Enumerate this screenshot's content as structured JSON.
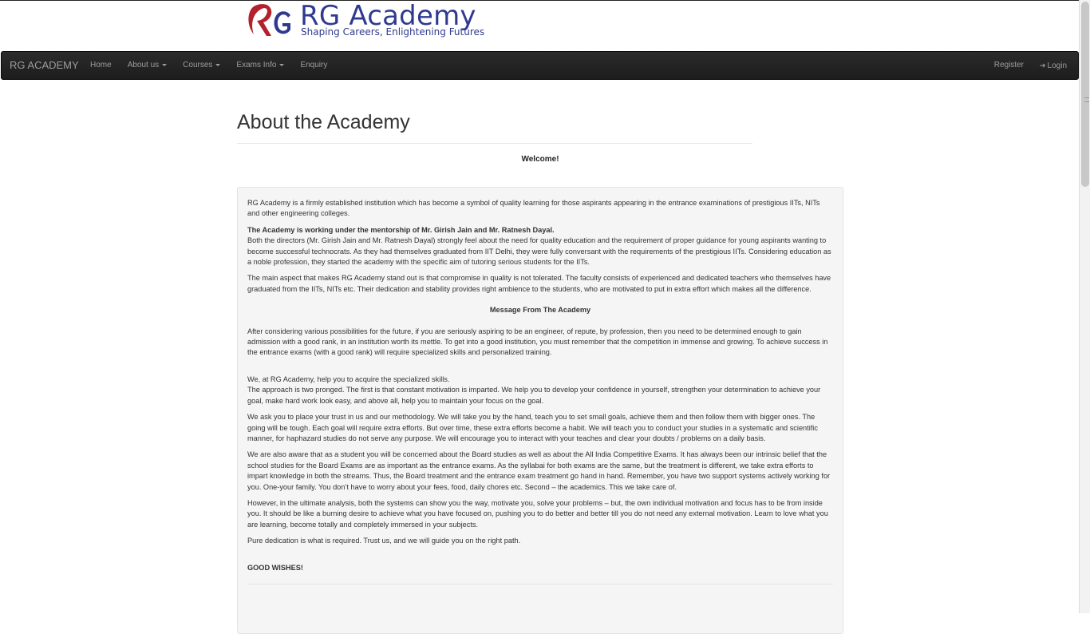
{
  "logo": {
    "name": "RG Academy",
    "tagline": "Shaping Careers, Enlightening Futures",
    "colors": {
      "primary": "#2f3a8f",
      "accent": "#b3222c"
    }
  },
  "navbar": {
    "brand": "RG ACADEMY",
    "items": [
      {
        "label": "Home"
      },
      {
        "label": "About us"
      },
      {
        "label": "Courses"
      },
      {
        "label": "Exams Info"
      },
      {
        "label": "Enquiry"
      }
    ],
    "right": [
      {
        "label": "Register"
      },
      {
        "label": "Login",
        "icon": "login-icon"
      }
    ]
  },
  "page": {
    "title": "About the Academy",
    "welcome": "Welcome!"
  },
  "content": {
    "p1": "RG Academy is a firmly established institution which has become a symbol of quality learning for those aspirants appearing in the entrance examinations of prestigious IITs, NITs and other engineering colleges.",
    "mentor": "The Academy is working under the mentorship of Mr. Girish Jain and Mr. Ratnesh Dayal.",
    "p2": "Both the directors (Mr. Girish Jain and Mr. Ratnesh Dayal) strongly feel about the need for quality education and the requirement of proper guidance for young aspirants wanting to become successful technocrats. As they had themselves graduated from IIT Delhi, they were fully conversant with the requirements of the prestigious IITs. Considering education as a noble profession, they started the academy with the specific aim of tutoring serious students for the IITs.",
    "p3": "The main aspect that makes RG Academy stand out is that compromise in quality is not tolerated. The faculty consists of experienced and dedicated teachers who themselves have graduated from the IITs, NITs etc. Their dedication and stability provides right ambience to the students, who are motivated to put in extra effort which makes all the difference.",
    "message_heading": "Message From The Academy",
    "p4": "After considering various possibilities for the future, if you are seriously aspiring to be an engineer, of repute, by profession, then you need to be determined enough to gain admission with a good rank, in an institution worth its mettle. To get into a good institution, you must remember that the competition in immense and growing. To achieve success in the entrance exams (with a good rank) will require specialized skills and personalized training.",
    "p5a": "We, at RG Academy, help you to acquire the specialized skills.",
    "p5b": "The approach is two pronged. The first is that constant motivation is imparted. We help you to develop your confidence in yourself, strengthen your determination to achieve your goal, make hard work look easy, and above all, help you to maintain your focus on the goal.",
    "p6": "We ask you to place your trust in us and our methodology. We will take you by the hand, teach you to set small goals, achieve them and then follow them with bigger ones. The going will be tough. Each goal will require extra efforts. But over time, these extra efforts become a habit. We will teach you to conduct your studies in a systematic and scientific manner, for haphazard studies do not serve any purpose. We will encourage you to interact with your teaches and clear your doubts / problems on a daily basis.",
    "p7": "We are also aware that as a student you will be concerned about the Board studies as well as about the All India Competitive Exams. It has always been our intrinsic belief that the school studies for the Board Exams are as important as the entrance exams. As the syllabai for both exams are the same, but the treatment is different, we take extra efforts to impart knowledge in both the streams. Thus, the Board treatment and the entrance exam treatment go hand in hand. Remember, you have two support systems actively working for you. One-your family. You don’t have to worry about your fees, food, daily chores etc. Second – the academics. This we take care of.",
    "p8": "However, in the ultimate analysis, both the systems can show you the way, motivate you, solve your problems – but, the own individual motivation and focus has to be from inside you. It should be like a burning desire to achieve what you have focused on, pushing you to do better and better till you do not need any external motivation. Learn to love what you are learning, become totally and completely immersed in your subjects.",
    "p9": "Pure dedication is what is required. Trust us, and we will guide you on the right path.",
    "closing": "GOOD WISHES!"
  }
}
